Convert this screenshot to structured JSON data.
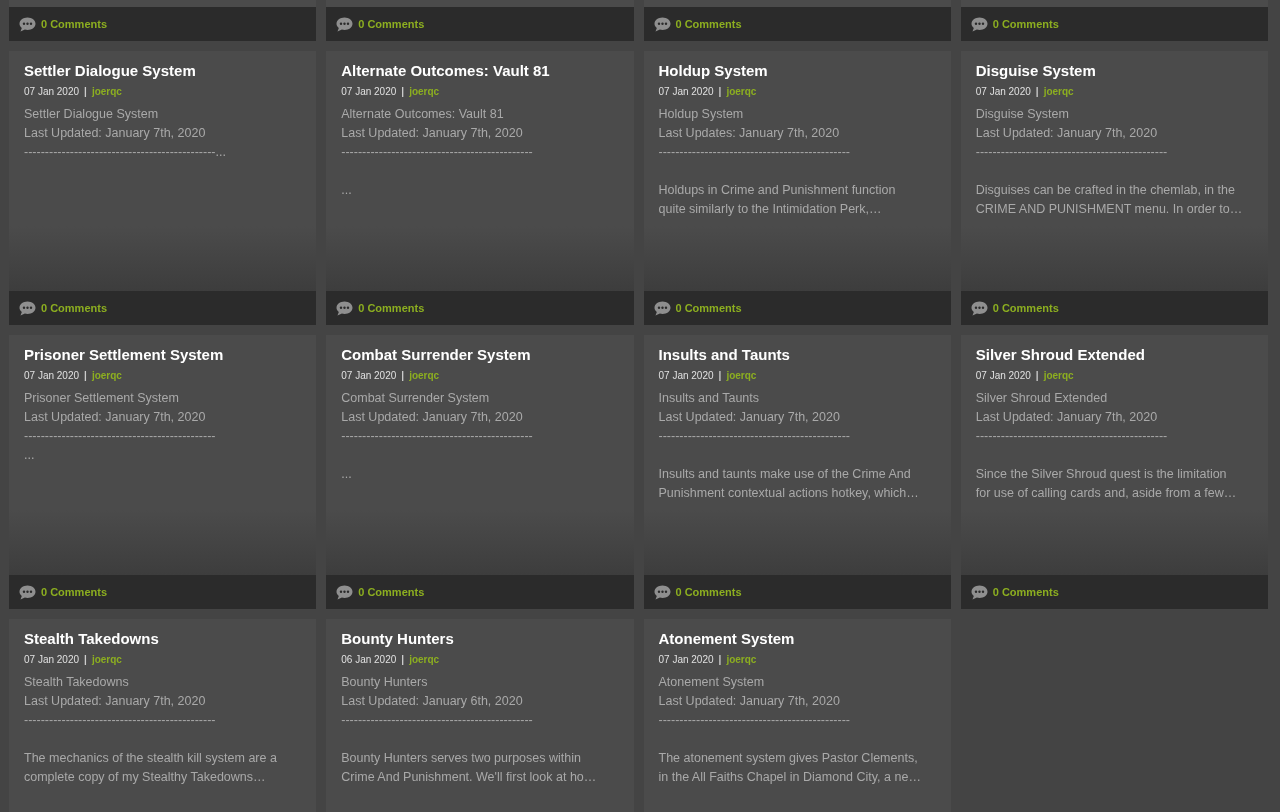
{
  "partial_cards": [
    {
      "comments": "0 Comments"
    },
    {
      "comments": "0 Comments"
    },
    {
      "comments": "0 Comments"
    },
    {
      "comments": "0 Comments"
    }
  ],
  "cards": [
    {
      "title": "Settler Dialogue System",
      "date": "07 Jan 2020",
      "separator": "|",
      "author": "joerqc",
      "intro": [
        "Settler Dialogue System",
        "Last Updated: January 7th, 2020",
        "----------------------------------------------..."
      ],
      "comments": "0 Comments"
    },
    {
      "title": "Alternate Outcomes: Vault 81",
      "date": "07 Jan 2020",
      "separator": "|",
      "author": "joerqc",
      "intro": [
        "Alternate Outcomes: Vault 81",
        "Last Updated: January 7th, 2020",
        "----------------------------------------------"
      ],
      "excerpt": [
        "..."
      ],
      "comments": "0 Comments"
    },
    {
      "title": "Holdup System",
      "date": "07 Jan 2020",
      "separator": "|",
      "author": "joerqc",
      "intro": [
        "Holdup System",
        "Last Updates: January 7th, 2020",
        "----------------------------------------------"
      ],
      "excerpt": [
        "Holdups in Crime and Punishment function",
        "quite similarly to the Intimidation Perk,…"
      ],
      "comments": "0 Comments"
    },
    {
      "title": "Disguise System",
      "date": "07 Jan 2020",
      "separator": "|",
      "author": "joerqc",
      "intro": [
        "Disguise System",
        "Last Updated: January 7th, 2020",
        "----------------------------------------------"
      ],
      "excerpt": [
        "Disguises can be crafted in the chemlab, in the",
        "CRIME AND PUNISHMENT menu. In order to…"
      ],
      "comments": "0 Comments"
    },
    {
      "title": "Prisoner Settlement System",
      "date": "07 Jan 2020",
      "separator": "|",
      "author": "joerqc",
      "intro": [
        "Prisoner Settlement System",
        "Last Updated: January 7th, 2020",
        "----------------------------------------------",
        "..."
      ],
      "comments": "0 Comments"
    },
    {
      "title": "Combat Surrender System",
      "date": "07 Jan 2020",
      "separator": "|",
      "author": "joerqc",
      "intro": [
        "Combat Surrender System",
        "Last Updated: January 7th, 2020",
        "----------------------------------------------"
      ],
      "excerpt": [
        "..."
      ],
      "comments": "0 Comments"
    },
    {
      "title": "Insults and Taunts",
      "date": "07 Jan 2020",
      "separator": "|",
      "author": "joerqc",
      "intro": [
        "Insults and Taunts",
        "Last Updated: January 7th, 2020",
        "----------------------------------------------"
      ],
      "excerpt": [
        "Insults and taunts make use of the Crime And",
        "Punishment contextual actions hotkey, which…"
      ],
      "comments": "0 Comments"
    },
    {
      "title": "Silver Shroud Extended",
      "date": "07 Jan 2020",
      "separator": "|",
      "author": "joerqc",
      "intro": [
        "Silver Shroud Extended",
        "Last Updated: January 7th, 2020",
        "----------------------------------------------"
      ],
      "excerpt": [
        "Since the Silver Shroud quest is the limitation",
        "for use of calling cards and, aside from a few…"
      ],
      "comments": "0 Comments"
    },
    {
      "title": "Stealth Takedowns",
      "date": "07 Jan 2020",
      "separator": "|",
      "author": "joerqc",
      "intro": [
        "Stealth Takedowns",
        "Last Updated: January 7th, 2020",
        "----------------------------------------------"
      ],
      "excerpt": [
        "The mechanics of the stealth kill system are a",
        "complete copy of my Stealthy Takedowns…"
      ]
    },
    {
      "title": "Bounty Hunters",
      "date": "06 Jan 2020",
      "separator": "|",
      "author": "joerqc",
      "intro": [
        "Bounty Hunters",
        "Last Updated: January 6th, 2020",
        "----------------------------------------------"
      ],
      "excerpt": [
        "Bounty Hunters serves two purposes within",
        "Crime And Punishment. We'll first look at ho…"
      ]
    },
    {
      "title": "Atonement System",
      "date": "07 Jan 2020",
      "separator": "|",
      "author": "joerqc",
      "intro": [
        "Atonement System",
        "Last Updated: January 7th, 2020",
        "----------------------------------------------"
      ],
      "excerpt": [
        "The atonement system gives Pastor Clements,",
        "in the All Faiths Chapel in Diamond City, a ne…"
      ]
    }
  ]
}
